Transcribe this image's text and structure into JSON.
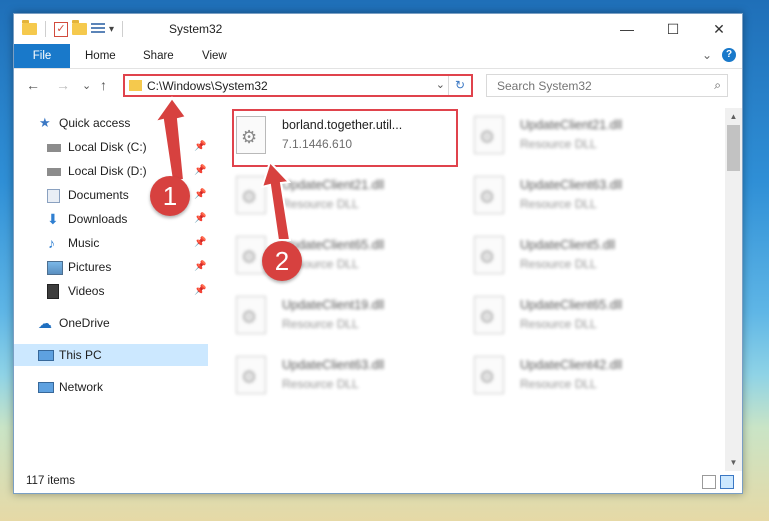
{
  "window": {
    "title": "System32",
    "caption": {
      "minimize": "—",
      "maximize": "☐",
      "close": "✕"
    }
  },
  "ribbon": {
    "tabs": [
      "File",
      "Home",
      "Share",
      "View"
    ],
    "expand_glyph": "⌄",
    "help_glyph": "?"
  },
  "nav": {
    "back": "←",
    "forward": "→",
    "recent": "⌄",
    "up": "↑",
    "address": "C:\\Windows\\System32",
    "address_dropdown": "⌄",
    "refresh": "↻",
    "search_placeholder": "Search System32",
    "search_glyph": "⌕"
  },
  "sidebar": {
    "items": [
      {
        "label": "Quick access",
        "icon": "star-icon",
        "pinned": false
      },
      {
        "label": "Local Disk (C:)",
        "icon": "drive-icon",
        "pinned": true
      },
      {
        "label": "Local Disk (D:)",
        "icon": "drive-icon",
        "pinned": true
      },
      {
        "label": "Documents",
        "icon": "documents-icon",
        "pinned": true
      },
      {
        "label": "Downloads",
        "icon": "downloads-icon",
        "pinned": true
      },
      {
        "label": "Music",
        "icon": "music-icon",
        "pinned": true
      },
      {
        "label": "Pictures",
        "icon": "pictures-icon",
        "pinned": true
      },
      {
        "label": "Videos",
        "icon": "videos-icon",
        "pinned": true
      },
      {
        "label": "OneDrive",
        "icon": "onedrive-icon",
        "pinned": false
      },
      {
        "label": "This PC",
        "icon": "this-pc-icon",
        "pinned": false
      },
      {
        "label": "Network",
        "icon": "network-icon",
        "pinned": false
      }
    ],
    "pin_glyph": "📌"
  },
  "files": [
    {
      "name": "borland.together.util...",
      "sub": "7.1.1446.610",
      "highlighted": true
    },
    {
      "name": "UpdateClient21.dll",
      "sub": "Resource DLL"
    },
    {
      "name": "UpdateClient21.dll",
      "sub": "Resource DLL"
    },
    {
      "name": "UpdateClient63.dll",
      "sub": "Resource DLL"
    },
    {
      "name": "UpdateClient65.dll",
      "sub": "Resource DLL"
    },
    {
      "name": "UpdateClient5.dll",
      "sub": "Resource DLL"
    },
    {
      "name": "UpdateClient19.dll",
      "sub": "Resource DLL"
    },
    {
      "name": "UpdateClient65.dll",
      "sub": "Resource DLL"
    },
    {
      "name": "UpdateClient63.dll",
      "sub": "Resource DLL"
    },
    {
      "name": "UpdateClient42.dll",
      "sub": "Resource DLL"
    }
  ],
  "status": {
    "item_count": "117 items"
  },
  "annotations": {
    "marker1": "1",
    "marker2": "2"
  },
  "colors": {
    "accent": "#1979ca",
    "highlight": "#e0434c",
    "marker": "#d7413f"
  }
}
